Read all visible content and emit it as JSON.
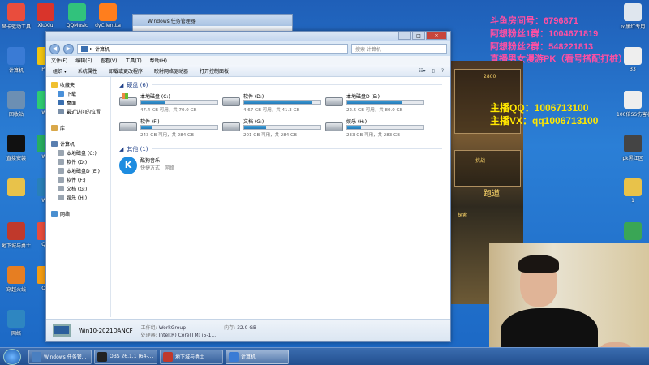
{
  "desktop": {
    "left_icons": [
      {
        "label": "显卡驱动工具",
        "color": "#e94d3d"
      },
      {
        "label": "计算机",
        "color": "#3a7bd5"
      },
      {
        "label": "回收站",
        "color": "#6c8fb3"
      },
      {
        "label": "直接安装",
        "color": "#111111"
      },
      {
        "label": "",
        "color": "#e8c24a"
      },
      {
        "label": "地下城与勇士",
        "color": "#c0392b"
      },
      {
        "label": "穿越火线",
        "color": "#e67e22"
      },
      {
        "label": "网络",
        "color": "#2e86c1"
      }
    ],
    "col2_icons": [
      {
        "label": "XiuXiu",
        "color": "#d9342b"
      },
      {
        "label": "Pot",
        "color": "#f1c40f"
      },
      {
        "label": "We",
        "color": "#2ecc71"
      },
      {
        "label": "We",
        "color": "#27ae60"
      },
      {
        "label": "We",
        "color": "#2980b9"
      },
      {
        "label": "QQ",
        "color": "#e74c3c"
      },
      {
        "label": "QQ",
        "color": "#f39c12"
      }
    ],
    "top_icons": [
      {
        "label": "QQMusic",
        "color": "#31c27c"
      },
      {
        "label": "dyClientLa",
        "color": "#ff7e1d"
      }
    ],
    "right_icons": [
      {
        "label": "zc黑红专用",
        "color": "#dfe6ee"
      },
      {
        "label": "33",
        "color": "#eeeeee"
      },
      {
        "label": "100倍SS伤害收益",
        "color": "#eeeeee"
      },
      {
        "label": "pk黑红区",
        "color": "#444444"
      },
      {
        "label": "1",
        "color": "#e8c24a"
      },
      {
        "label": "",
        "color": "#3aa655"
      }
    ]
  },
  "overlay": {
    "room": "斗鱼房间号：6796871",
    "fan1": "阿想粉丝1群：1004671819",
    "fan2": "阿想粉丝2群：548221813",
    "stream_desc": "直播男女漫游PK（看号搭配打桩）",
    "qq": "主播QQ：1006713100",
    "vx": "主播VX：qq1006713100"
  },
  "taskmgr": {
    "title": "Windows 任务管理器"
  },
  "explorer": {
    "address": "计算机",
    "search_placeholder": "搜索 计算机",
    "menu": [
      "文件(F)",
      "编辑(E)",
      "查看(V)",
      "工具(T)",
      "帮助(H)"
    ],
    "toolbar": [
      "组织 ▾",
      "系统属性",
      "卸载或更改程序",
      "映射网络驱动器",
      "打开控制面板"
    ],
    "nav": [
      {
        "label": "收藏夹",
        "sub": false,
        "color": "#f0c030"
      },
      {
        "label": "下载",
        "sub": true,
        "color": "#4a90d9"
      },
      {
        "label": "桌面",
        "sub": true,
        "color": "#3a6fb0"
      },
      {
        "label": "最近访问的位置",
        "sub": true,
        "color": "#7a8fa8"
      },
      {
        "gap": true
      },
      {
        "label": "库",
        "sub": false,
        "color": "#d9a84a"
      },
      {
        "gap": true
      },
      {
        "label": "计算机",
        "sub": false,
        "color": "#5a7fb0"
      },
      {
        "label": "本地磁盘 (C:)",
        "sub": true,
        "color": "#9aa5b1"
      },
      {
        "label": "软件 (D:)",
        "sub": true,
        "color": "#9aa5b1"
      },
      {
        "label": "本地磁盘D (E:)",
        "sub": true,
        "color": "#9aa5b1"
      },
      {
        "label": "软件 (F:)",
        "sub": true,
        "color": "#9aa5b1"
      },
      {
        "label": "文档 (G:)",
        "sub": true,
        "color": "#9aa5b1"
      },
      {
        "label": "娱乐 (H:)",
        "sub": true,
        "color": "#9aa5b1"
      },
      {
        "gap": true
      },
      {
        "label": "网络",
        "sub": false,
        "color": "#4a8fd0"
      }
    ],
    "drives_header": "硬盘 (6)",
    "drives": [
      {
        "name": "本地磁盘 (C:)",
        "free": "47.4 GB 可用，共 70.0 GB",
        "used": 0.32,
        "sys": true
      },
      {
        "name": "软件 (D:)",
        "free": "4.67 GB 可用，共 41.3 GB",
        "used": 0.89,
        "sys": false
      },
      {
        "name": "本地磁盘D (E:)",
        "free": "22.5 GB 可用，共 80.0 GB",
        "used": 0.72,
        "sys": false
      },
      {
        "name": "软件 (F:)",
        "free": "243 GB 可用，共 284 GB",
        "used": 0.14,
        "sys": false
      },
      {
        "name": "文档 (G:)",
        "free": "201 GB 可用，共 284 GB",
        "used": 0.29,
        "sys": false
      },
      {
        "name": "娱乐 (H:)",
        "free": "233 GB 可用，共 283 GB",
        "used": 0.18,
        "sys": false
      }
    ],
    "other_header": "其他 (1)",
    "other_item": {
      "name": "酷狗音乐",
      "sub": "快捷方式，网络",
      "logo": "K"
    },
    "details": {
      "computer_name": "Win10-2021DANCF",
      "workgroup_key": "工作组:",
      "workgroup_val": "WorkGroup",
      "memory_key": "内存:",
      "memory_val": "32.0 GB",
      "cpu_key": "处理器:",
      "cpu_val": "Intel(R) Core(TM) i5-1..."
    }
  },
  "game": {
    "t1": "2800",
    "t2": "挑战",
    "t3": "跑道",
    "t4": "探索"
  },
  "taskbar": {
    "items": [
      {
        "label": "Windows 任务管...",
        "color": "#4a7fc0",
        "active": false
      },
      {
        "label": "OBS 26.1.1 (64-...",
        "color": "#222222",
        "active": false
      },
      {
        "label": "地下城与勇士",
        "color": "#c0392b",
        "active": false
      },
      {
        "label": "计算机",
        "color": "#3a7bd5",
        "active": true
      }
    ]
  }
}
